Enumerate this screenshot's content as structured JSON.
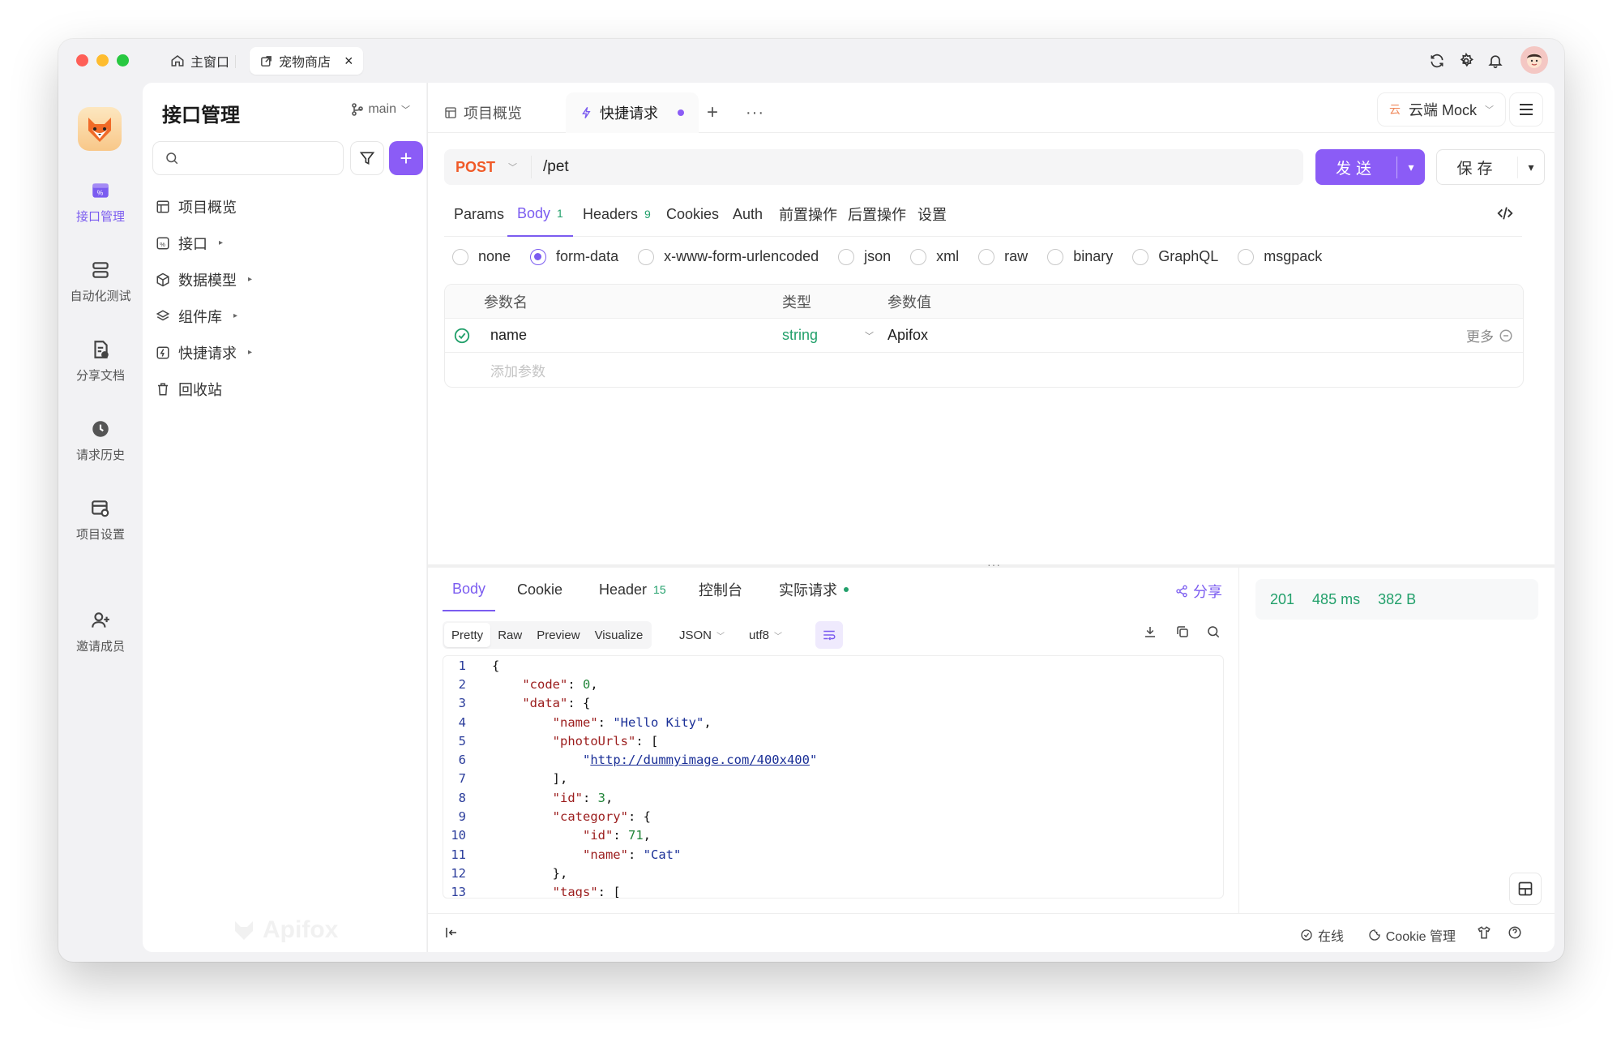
{
  "window": {
    "tabs": [
      {
        "label": "主窗口"
      },
      {
        "label": "宠物商店"
      }
    ]
  },
  "rail": [
    {
      "label": "接口管理"
    },
    {
      "label": "自动化测试"
    },
    {
      "label": "分享文档"
    },
    {
      "label": "请求历史"
    },
    {
      "label": "项目设置"
    },
    {
      "label": "邀请成员"
    }
  ],
  "sidebar": {
    "title": "接口管理",
    "branch": "main",
    "search_placeholder": "",
    "tree": [
      {
        "label": "项目概览"
      },
      {
        "label": "接口"
      },
      {
        "label": "数据模型"
      },
      {
        "label": "组件库"
      },
      {
        "label": "快捷请求"
      },
      {
        "label": "回收站"
      }
    ],
    "watermark": "Apifox"
  },
  "main": {
    "tabs": [
      {
        "label": "项目概览"
      },
      {
        "label": "快捷请求"
      }
    ],
    "mock": "云端 Mock",
    "mock_icon": "云",
    "method": "POST",
    "url": "/pet",
    "send": "发送",
    "save": "保存",
    "req_tabs": [
      {
        "label": "Params"
      },
      {
        "label": "Body",
        "badge": "1"
      },
      {
        "label": "Headers",
        "badge": "9"
      },
      {
        "label": "Cookies"
      },
      {
        "label": "Auth"
      },
      {
        "label": "前置操作"
      },
      {
        "label": "后置操作"
      },
      {
        "label": "设置"
      }
    ],
    "body_types": [
      "none",
      "form-data",
      "x-www-form-urlencoded",
      "json",
      "xml",
      "raw",
      "binary",
      "GraphQL",
      "msgpack"
    ],
    "body_selected": "form-data",
    "param_headers": [
      "参数名",
      "类型",
      "参数值"
    ],
    "params": [
      {
        "name": "name",
        "type": "string",
        "value": "Apifox",
        "more": "更多"
      }
    ],
    "add_param_placeholder": "添加参数"
  },
  "response": {
    "tabs": [
      {
        "label": "Body"
      },
      {
        "label": "Cookie"
      },
      {
        "label": "Header",
        "badge": "15"
      },
      {
        "label": "控制台"
      },
      {
        "label": "实际请求"
      }
    ],
    "share": "分享",
    "views": [
      "Pretty",
      "Raw",
      "Preview",
      "Visualize"
    ],
    "format": "JSON",
    "encoding": "utf8",
    "status": "201",
    "time": "485 ms",
    "size": "382 B",
    "code_lines": [
      "{",
      "    \"code\": 0,",
      "    \"data\": {",
      "        \"name\": \"Hello Kity\",",
      "        \"photoUrls\": [",
      "            \"http://dummyimage.com/400x400\"",
      "        ],",
      "        \"id\": 3,",
      "        \"category\": {",
      "            \"id\": 71,",
      "            \"name\": \"Cat\"",
      "        },",
      "        \"tags\": ["
    ]
  },
  "footer": {
    "online": "在线",
    "cookie": "Cookie 管理"
  },
  "colors": {
    "accent": "#8b5cf6",
    "post": "#f05a28",
    "success": "#22a06b"
  }
}
